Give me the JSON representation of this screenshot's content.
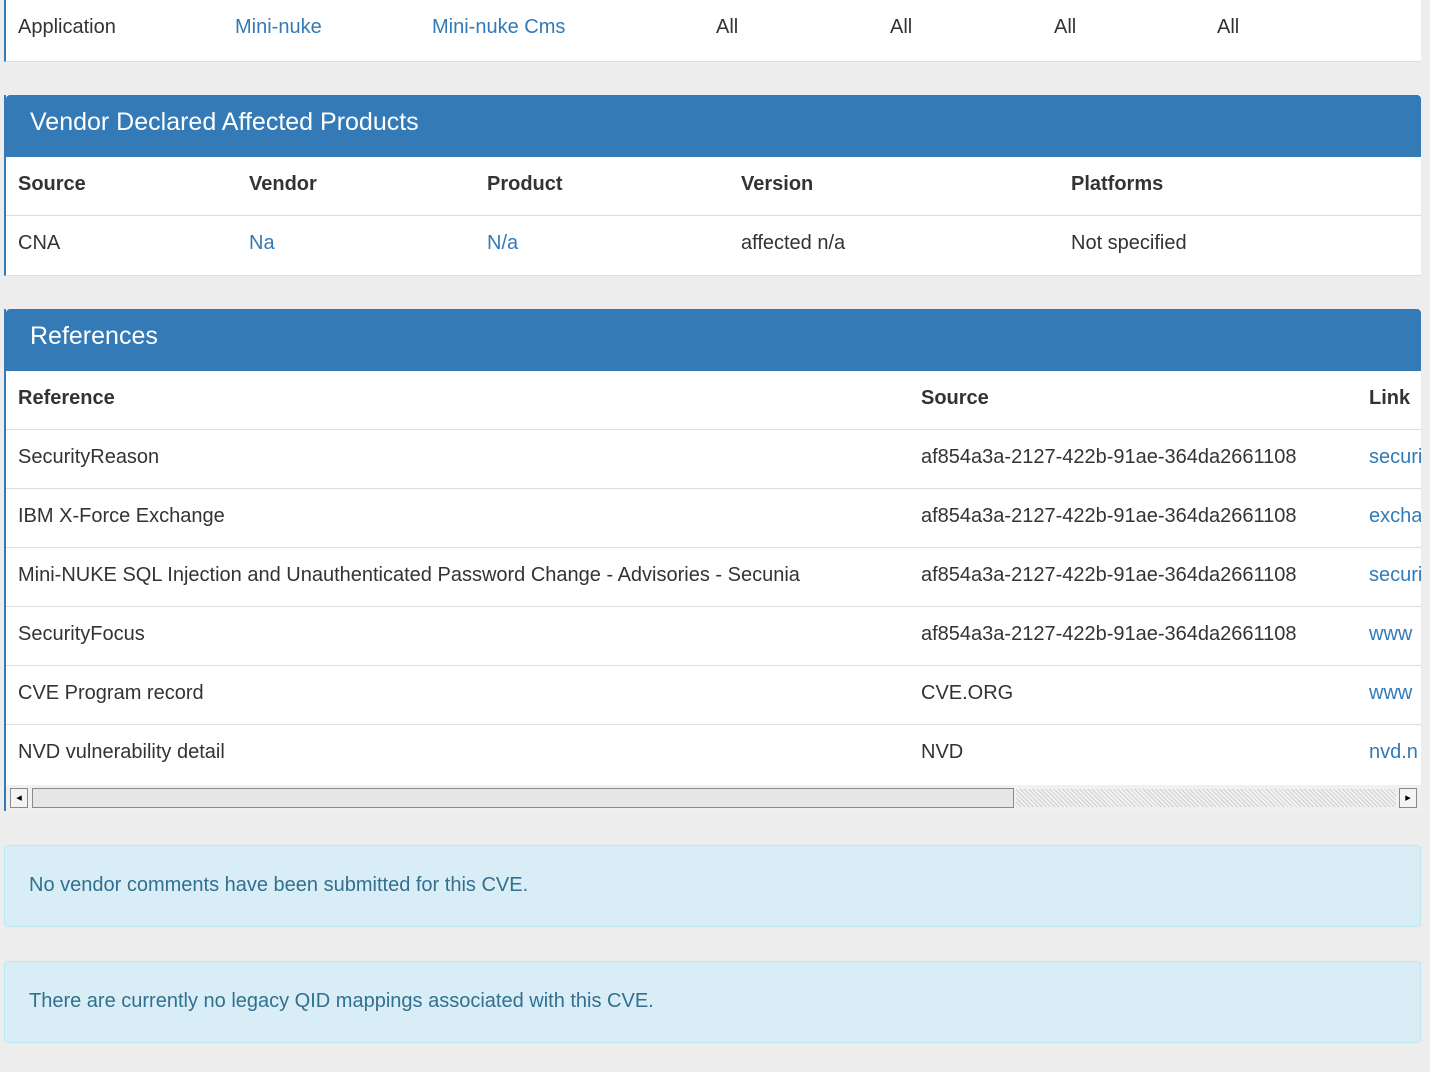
{
  "top_row": {
    "type": "Application",
    "vendor": "Mini-nuke",
    "product": "Mini-nuke Cms",
    "version": "All",
    "update": "All",
    "edition": "All",
    "language": "All"
  },
  "vendor_panel": {
    "title": "Vendor Declared Affected Products",
    "headers": {
      "source": "Source",
      "vendor": "Vendor",
      "product": "Product",
      "version": "Version",
      "platforms": "Platforms"
    },
    "rows": [
      {
        "source": "CNA",
        "vendor": "Na",
        "product": "N/a",
        "version": "affected n/a",
        "platforms": "Not specified"
      }
    ]
  },
  "references_panel": {
    "title": "References",
    "headers": {
      "reference": "Reference",
      "source": "Source",
      "link": "Link"
    },
    "rows": [
      {
        "reference": "SecurityReason",
        "source": "af854a3a-2127-422b-91ae-364da2661108",
        "link": "securi"
      },
      {
        "reference": "IBM X-Force Exchange",
        "source": "af854a3a-2127-422b-91ae-364da2661108",
        "link": "excha"
      },
      {
        "reference": "Mini-NUKE SQL Injection and Unauthenticated Password Change - Advisories - Secunia",
        "source": "af854a3a-2127-422b-91ae-364da2661108",
        "link": "securi"
      },
      {
        "reference": "SecurityFocus",
        "source": "af854a3a-2127-422b-91ae-364da2661108",
        "link": "www"
      },
      {
        "reference": "CVE Program record",
        "source": "CVE.ORG",
        "link": "www"
      },
      {
        "reference": "NVD vulnerability detail",
        "source": "NVD",
        "link": "nvd.n"
      }
    ],
    "scrollbar": {
      "left_icon": "arrow-left-icon",
      "right_icon": "arrow-right-icon",
      "left_glyph": "◂",
      "right_glyph": "▸"
    }
  },
  "alerts": {
    "vendor_comments": "No vendor comments have been submitted for this CVE.",
    "qid_mappings": "There are currently no legacy QID mappings associated with this CVE."
  },
  "colors": {
    "accent": "#337ab7",
    "alert_bg": "#d9edf7",
    "alert_text": "#31708f",
    "page_bg": "#ededed"
  }
}
